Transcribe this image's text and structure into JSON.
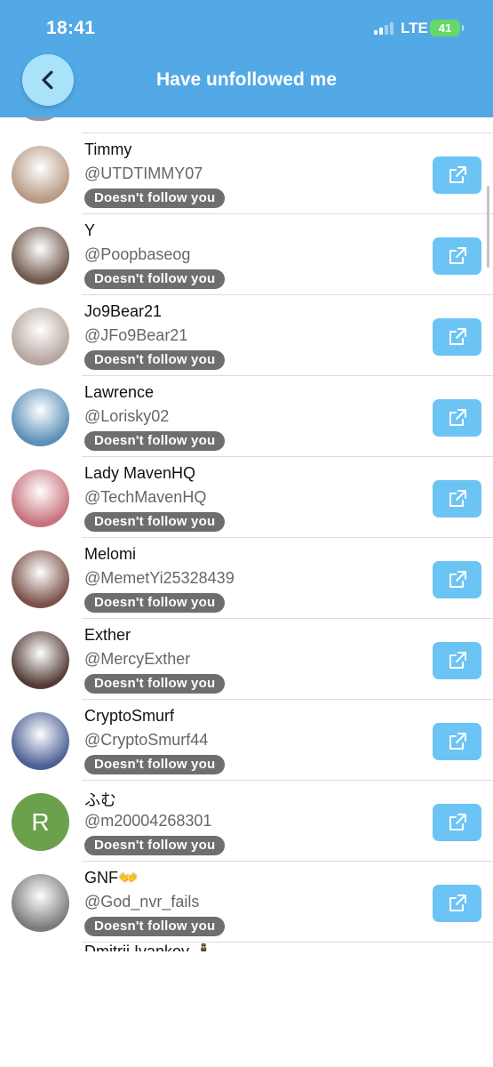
{
  "status_bar": {
    "time": "18:41",
    "network": "LTE",
    "battery": "41"
  },
  "header": {
    "title": "Have unfollowed me",
    "back_icon": "chevron-left-icon"
  },
  "colors": {
    "header_bg": "#52a9e6",
    "back_button_bg": "#a8e3fb",
    "open_button_bg": "#6cc4f5",
    "badge_bg": "#6e6e6e"
  },
  "users": [
    {
      "name": "Timmy",
      "handle": "@UTDTIMMY07",
      "badge": "Doesn't follow you",
      "avatar_color": "#b89a85"
    },
    {
      "name": "Y",
      "handle": "@Poopbaseog",
      "badge": "Doesn't follow you",
      "avatar_color": "#6f5a4c"
    },
    {
      "name": "Jo9Bear21",
      "handle": "@JFo9Bear21",
      "badge": "Doesn't follow you",
      "avatar_color": "#b5a79e"
    },
    {
      "name": "Lawrence",
      "handle": "@Lorisky02",
      "badge": "Doesn't follow you",
      "avatar_color": "#5b8fb7"
    },
    {
      "name": "Lady MavenHQ",
      "handle": "@TechMavenHQ",
      "badge": "Doesn't follow you",
      "avatar_color": "#c7727c"
    },
    {
      "name": "Melomi",
      "handle": "@MemetYi25328439",
      "badge": "Doesn't follow you",
      "avatar_color": "#7a5149"
    },
    {
      "name": "Exther",
      "handle": "@MercyExther",
      "badge": "Doesn't follow you",
      "avatar_color": "#533b35"
    },
    {
      "name": "CryptoSmurf",
      "handle": "@CryptoSmurf44",
      "badge": "Doesn't follow you",
      "avatar_color": "#4d5f95"
    },
    {
      "name": "ふむ",
      "handle": "@m20004268301",
      "badge": "Doesn't follow you",
      "avatar_color": "#6ba04d",
      "avatar_letter": "R"
    },
    {
      "name": "GNF👐",
      "handle": "@God_nvr_fails",
      "badge": "Doesn't follow you",
      "avatar_color": "#7b7b7b"
    }
  ],
  "partial_next_name": "Dmitrii Ivankov 🕴"
}
